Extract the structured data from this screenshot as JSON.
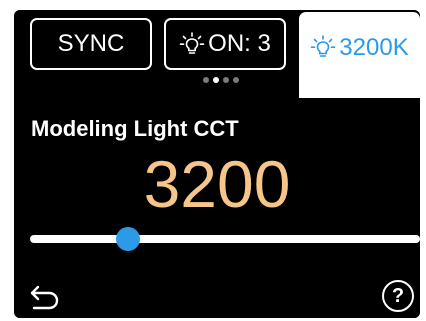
{
  "tabs": {
    "sync": {
      "label": "SYNC"
    },
    "on": {
      "label": "ON: 3",
      "icon": "lightbulb-icon"
    },
    "cct": {
      "label": "3200K",
      "icon": "lightbulb-icon"
    }
  },
  "pager": {
    "count": 4,
    "active_index": 1
  },
  "main": {
    "title": "Modeling Light CCT",
    "value": "3200",
    "slider": {
      "fraction": 0.25
    }
  },
  "footer": {
    "back_icon": "back-arrow-icon",
    "help_label": "?"
  },
  "colors": {
    "accent": "#2b9be8",
    "value": "#f6c58a",
    "background": "#000000",
    "foreground": "#ffffff"
  }
}
